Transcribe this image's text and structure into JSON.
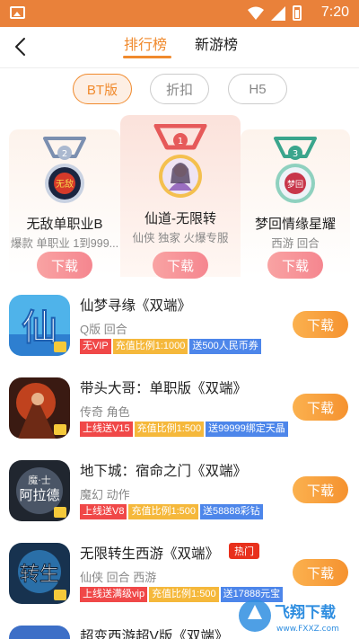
{
  "status": {
    "time": "7:20"
  },
  "header": {
    "tabs": [
      {
        "label": "排行榜",
        "active": true
      },
      {
        "label": "新游榜",
        "active": false
      }
    ]
  },
  "filters": [
    {
      "label": "BT版",
      "active": true
    },
    {
      "label": "折扣",
      "active": false
    },
    {
      "label": "H5",
      "active": false
    }
  ],
  "podium": [
    {
      "rank": "2",
      "name": "无敌单职业B",
      "tags": "爆款 单职业 1到999...",
      "download": "下载"
    },
    {
      "rank": "1",
      "name": "仙道-无限转",
      "tags": "仙侠  独家 火爆专服",
      "download": "下载"
    },
    {
      "rank": "3",
      "name": "梦回情缘星耀",
      "tags": "西游  回合",
      "download": "下载"
    }
  ],
  "games": [
    {
      "title": "仙梦寻缘《双端》",
      "sub": "Q版 回合",
      "tags": [
        {
          "text": "无VIP",
          "color": "red"
        },
        {
          "text": "充值比例1:1000",
          "color": "yellow"
        },
        {
          "text": "送500人民币券",
          "color": "blue"
        }
      ],
      "download": "下载"
    },
    {
      "title": "带头大哥：单职版《双端》",
      "sub": "传奇 角色",
      "tags": [
        {
          "text": "上线送V15",
          "color": "red"
        },
        {
          "text": "充值比例1:500",
          "color": "yellow"
        },
        {
          "text": "送99999绑定天晶",
          "color": "blue"
        }
      ],
      "download": "下载"
    },
    {
      "title": "地下城：宿命之门《双端》",
      "sub": "魔幻 动作",
      "tags": [
        {
          "text": "上线送V8",
          "color": "red"
        },
        {
          "text": "充值比例1:500",
          "color": "yellow"
        },
        {
          "text": "送58888彩钻",
          "color": "blue"
        }
      ],
      "download": "下载"
    },
    {
      "title": "无限转生西游《双端》",
      "hot": "热门",
      "sub": "仙侠 回合 西游",
      "tags": [
        {
          "text": "上线送满级vip",
          "color": "red"
        },
        {
          "text": "充值比例1:500",
          "color": "yellow"
        },
        {
          "text": "送17888元宝",
          "color": "blue"
        }
      ],
      "download": "下载"
    },
    {
      "title": "超变西游超V版《双端》",
      "sub": "",
      "tags": [],
      "download": ""
    }
  ],
  "icon_texts": {
    "podium2": "无敌",
    "podium3": "梦回",
    "g1": "仙",
    "g3_line1": "魔·士",
    "g3_line2": "阿拉德",
    "g4": "转生"
  },
  "watermark": {
    "text": "飞翔下载",
    "url": "www.FXXZ.com"
  },
  "colors": {
    "accent": "#f08a2d",
    "statusbar": "#e9813a",
    "download_orange": "#f5922f",
    "download_pink": "#f5868f"
  }
}
